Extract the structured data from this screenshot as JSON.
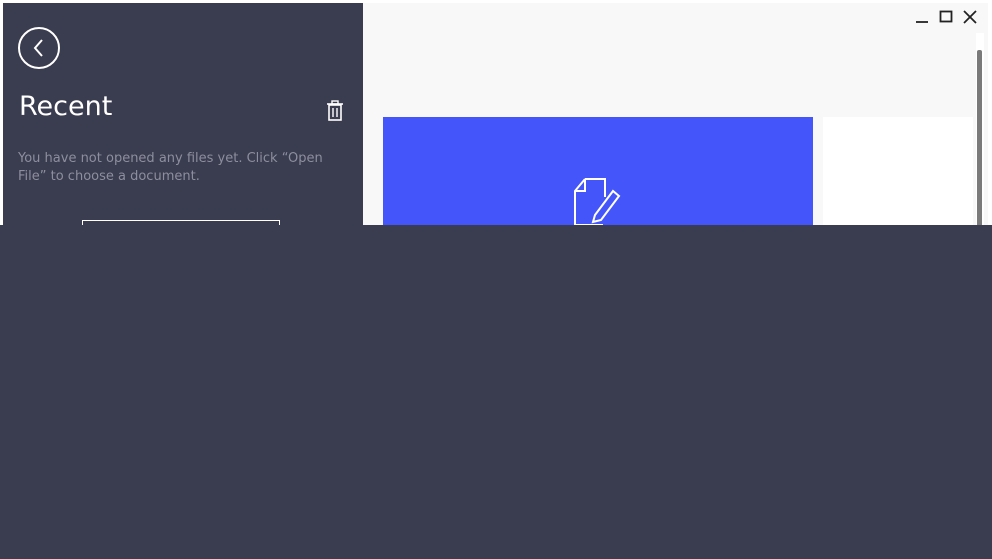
{
  "sidebar": {
    "title": "Recent",
    "empty_message": "You have not opened any files yet. Click “Open File” to choose a document.",
    "icons": {
      "back": "chevron-left-icon",
      "clear": "trash-icon",
      "open_file": "folder-icon"
    }
  },
  "window": {
    "controls": [
      "minimize",
      "maximize",
      "close"
    ]
  },
  "main": {
    "cards": [
      {
        "icon": "edit-document-icon",
        "color": "#4455f9"
      },
      {
        "color": "#ffffff"
      }
    ]
  },
  "colors": {
    "sidebar_bg": "#3a3c50",
    "accent": "#4455f9",
    "muted_text": "#8d8f9e"
  }
}
